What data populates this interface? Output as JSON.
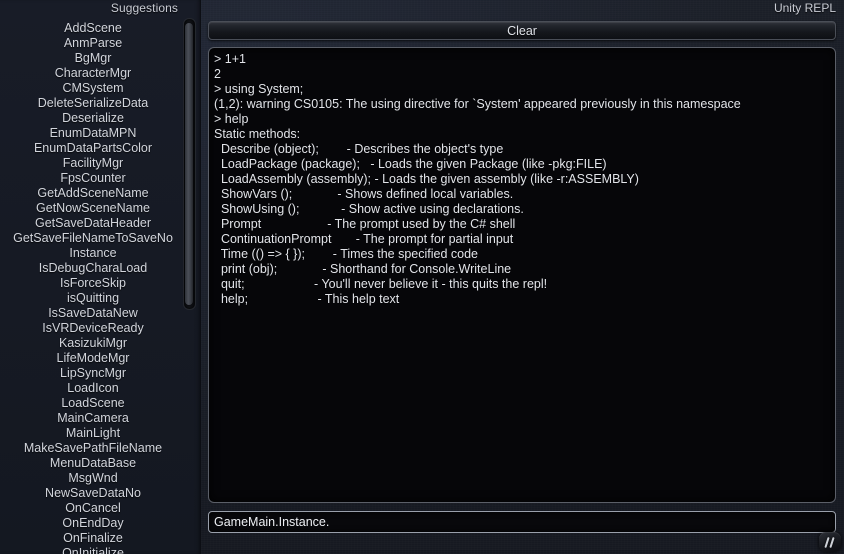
{
  "window": {
    "title": "Unity REPL"
  },
  "suggestions": {
    "header": "Suggestions",
    "items": [
      "AddScene",
      "AnmParse",
      "BgMgr",
      "CharacterMgr",
      "CMSystem",
      "DeleteSerializeData",
      "Deserialize",
      "EnumDataMPN",
      "EnumDataPartsColor",
      "FacilityMgr",
      "FpsCounter",
      "GetAddSceneName",
      "GetNowSceneName",
      "GetSaveDataHeader",
      "GetSaveFileNameToSaveNo",
      "Instance",
      "IsDebugCharaLoad",
      "IsForceSkip",
      "isQuitting",
      "IsSaveDataNew",
      "IsVRDeviceReady",
      "KasizukiMgr",
      "LifeModeMgr",
      "LipSyncMgr",
      "LoadIcon",
      "LoadScene",
      "MainCamera",
      "MainLight",
      "MakeSavePathFileName",
      "MenuDataBase",
      "MsgWnd",
      "NewSaveDataNo",
      "OnCancel",
      "OnEndDay",
      "OnFinalize",
      "OnInitialize"
    ],
    "scrollbar": {
      "thumb_position_percent": 0,
      "thumb_size_percent": 54
    }
  },
  "toolbar": {
    "clear_label": "Clear"
  },
  "console": {
    "lines": [
      "> 1+1",
      "2",
      "> using System;",
      "(1,2): warning CS0105: The using directive for `System' appeared previously in this namespace",
      "> help",
      "Static methods:",
      "  Describe (object);        - Describes the object's type",
      "  LoadPackage (package);   - Loads the given Package (like -pkg:FILE)",
      "  LoadAssembly (assembly); - Loads the given assembly (like -r:ASSEMBLY)",
      "  ShowVars ();             - Shows defined local variables.",
      "  ShowUsing ();            - Show active using declarations.",
      "  Prompt                   - The prompt used by the C# shell",
      "  ContinuationPrompt       - The prompt for partial input",
      "  Time (() => { });        - Times the specified code",
      "  print (obj);             - Shorthand for Console.WriteLine",
      "  quit;                    - You'll never believe it - this quits the repl!",
      "  help;                    - This help text"
    ]
  },
  "input": {
    "value": "GameMain.Instance.",
    "placeholder": ""
  },
  "resize_grip": {
    "icon": "resize-handle-icon"
  },
  "colors": {
    "background": "#181c27",
    "console_background": "#060609",
    "text": "#e2e4e9",
    "border": "#5b5f68"
  }
}
